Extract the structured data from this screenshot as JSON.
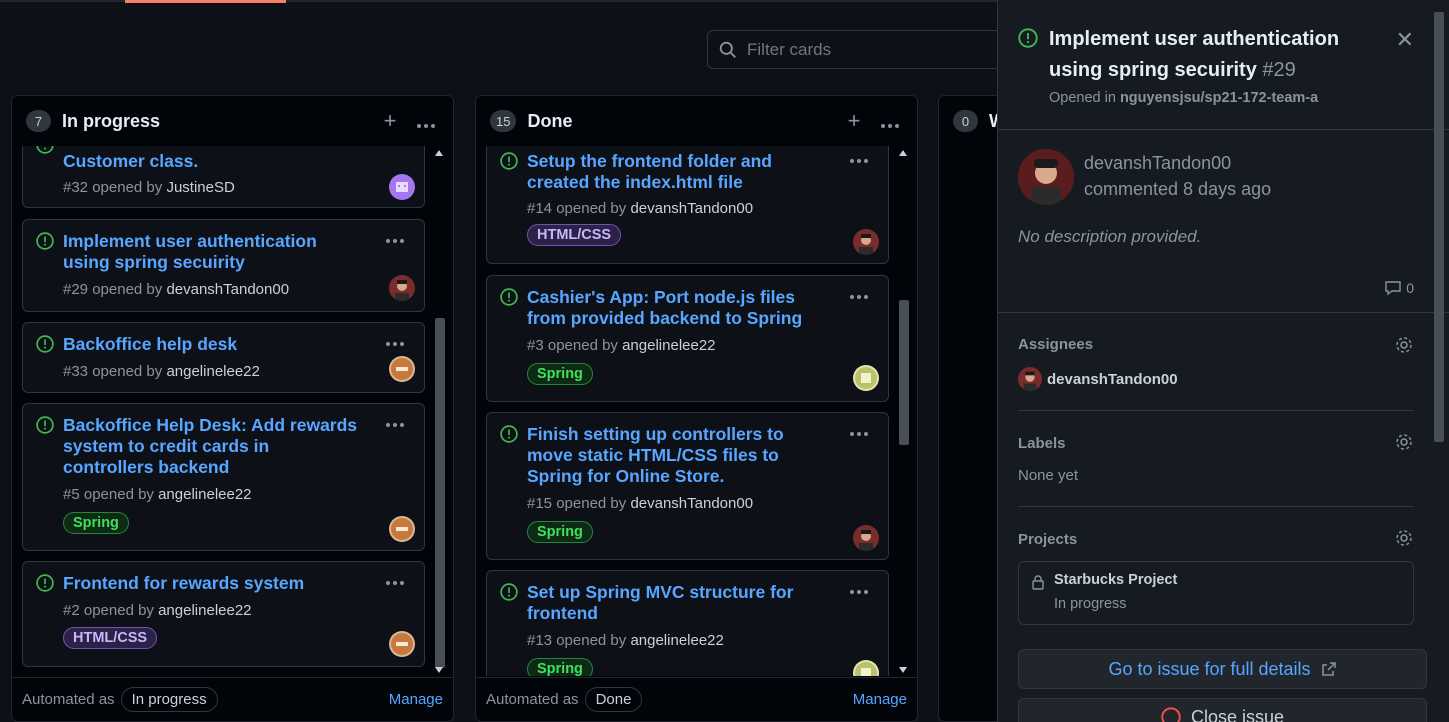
{
  "filter": {
    "placeholder": "Filter cards"
  },
  "columns": [
    {
      "count": "7",
      "title": "In progress",
      "automated_label": "Automated as",
      "automated_value": "In progress",
      "manage": "Manage",
      "cards": [
        {
          "title": "Customer class.",
          "meta": "#32 opened by",
          "author": "JustineSD"
        },
        {
          "title": "Implement user authentication using spring secuirity",
          "meta": "#29 opened by",
          "author": "devanshTandon00"
        },
        {
          "title": "Backoffice help desk",
          "meta": "#33 opened by",
          "author": "angelinelee22"
        },
        {
          "title": "Backoffice Help Desk: Add rewards system to credit cards in controllers backend",
          "meta": "#5 opened by",
          "author": "angelinelee22",
          "label": "Spring"
        },
        {
          "title": "Frontend for rewards system",
          "meta": "#2 opened by",
          "author": "angelinelee22",
          "label": "HTML/CSS"
        }
      ]
    },
    {
      "count": "15",
      "title": "Done",
      "automated_label": "Automated as",
      "automated_value": "Done",
      "manage": "Manage",
      "cards": [
        {
          "title": "Setup the frontend folder and created the index.html file",
          "meta": "#14 opened by",
          "author": "devanshTandon00",
          "label": "HTML/CSS"
        },
        {
          "title": "Cashier's App: Port node.js files from provided backend to Spring",
          "meta": "#3 opened by",
          "author": "angelinelee22",
          "label": "Spring"
        },
        {
          "title": "Finish setting up controllers to move static HTML/CSS files to Spring for Online Store.",
          "meta": "#15 opened by",
          "author": "devanshTandon00",
          "label": "Spring"
        },
        {
          "title": "Set up Spring MVC structure for frontend",
          "meta": "#13 opened by",
          "author": "angelinelee22",
          "label": "Spring"
        }
      ]
    },
    {
      "count": "0",
      "title": "W"
    }
  ],
  "panel": {
    "title": "Implement user authentication using spring secuirity",
    "number": "#29",
    "opened_prefix": "Opened in",
    "repo": "nguyensjsu/sp21-172-team-a",
    "commenter": "devanshTandon00",
    "comment_time": "commented 8 days ago",
    "description": "No description provided.",
    "comment_count": "0",
    "assignees_title": "Assignees",
    "assignee": "devanshTandon00",
    "labels_title": "Labels",
    "labels_value": "None yet",
    "projects_title": "Projects",
    "project_name": "Starbucks Project",
    "project_status": "In progress",
    "go_button": "Go to issue for full details",
    "close_button": "Close issue"
  },
  "colors": {
    "link": "#58a6ff",
    "open_icon": "#3fb950",
    "spring": "#3fe05c",
    "html": "#c9b6ff"
  }
}
